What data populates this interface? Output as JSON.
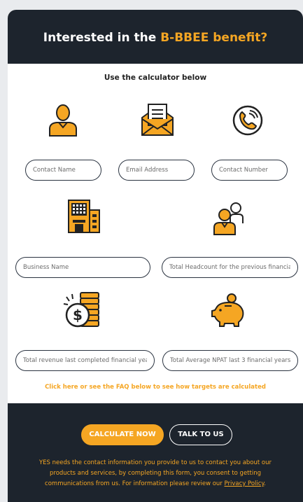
{
  "header": {
    "title_prefix": "Interested in the ",
    "title_accent": "B-BBEE benefit?"
  },
  "subtitle": "Use the calculator below",
  "fields": {
    "contact_name": "Contact Name",
    "email_address": "Email Address",
    "contact_number": "Contact Number",
    "business_name": "Business Name",
    "headcount": "Total Headcount for the previous financial year",
    "revenue": "Total revenue last completed financial year",
    "npat": "Total Average NPAT last 3 financial years"
  },
  "icons": [
    "person-icon",
    "email-icon",
    "phone-icon",
    "building-icon",
    "team-icon",
    "money-coins-icon",
    "piggy-bank-icon"
  ],
  "hint_link": "Click here or see the FAQ below to see how targets are calculated",
  "buttons": {
    "calculate": "CALCULATE NOW",
    "talk": "TALK TO US"
  },
  "consent": {
    "text": "YES needs the contact information you provide to us to contact you about our products and services, by completing this form, you consent to getting communications from us. For information please review our ",
    "link": "Privacy Policy",
    "end": "."
  },
  "colors": {
    "accent": "#f5a623",
    "dark": "#1d242d"
  }
}
